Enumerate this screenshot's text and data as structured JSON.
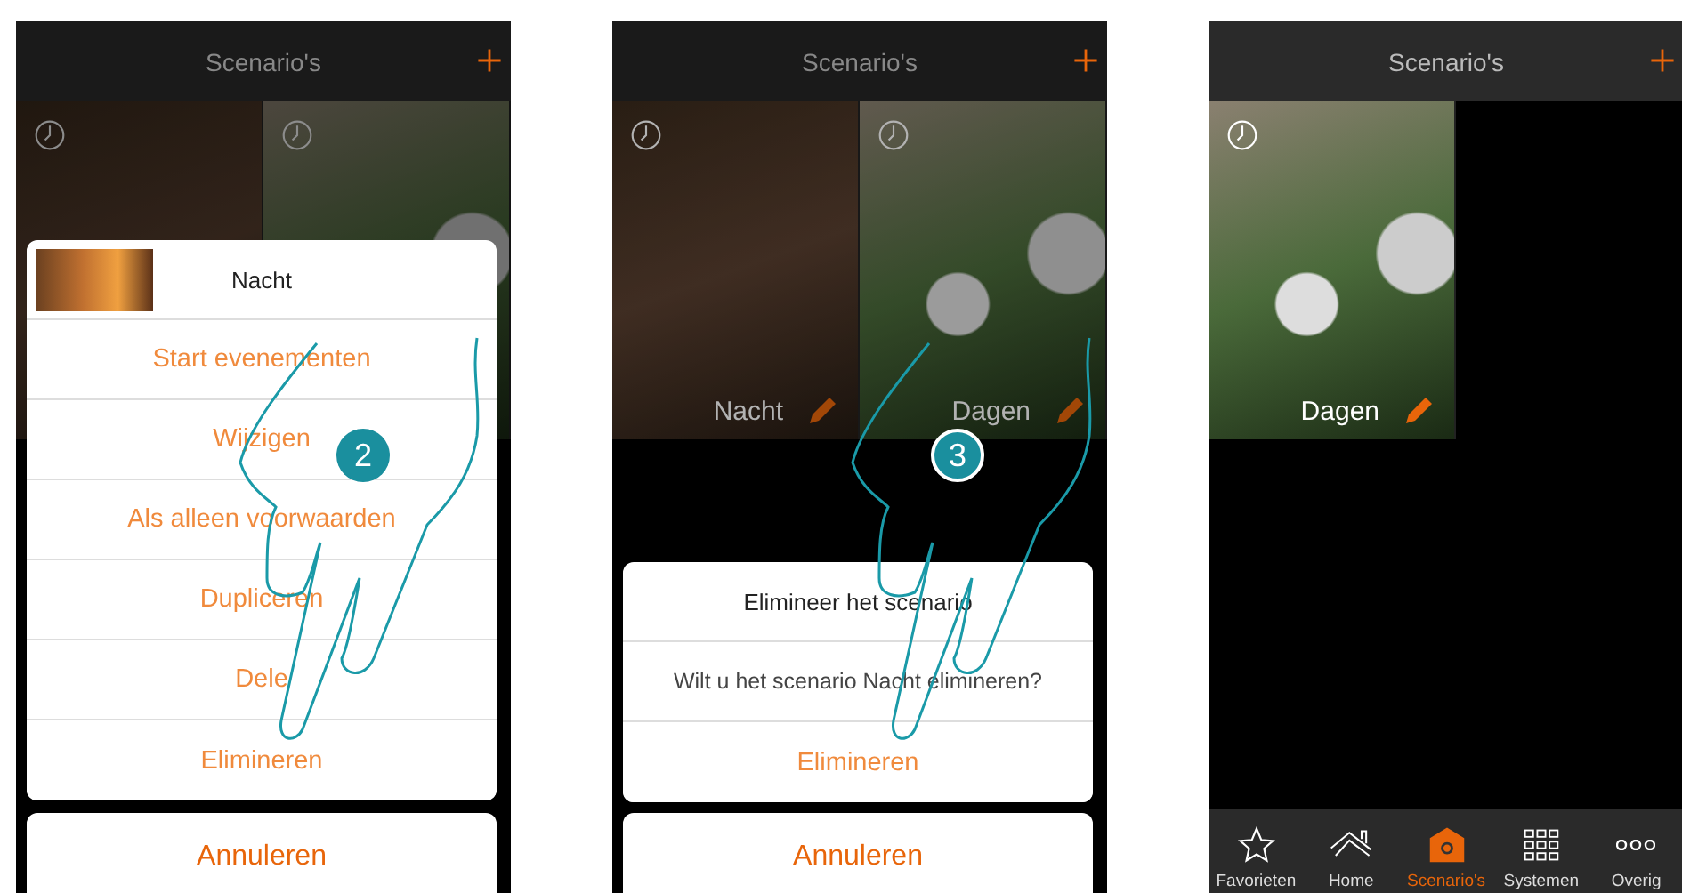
{
  "screens": [
    {
      "kind": "menu",
      "title": "Scenario's",
      "tiles": [
        {
          "kind": "fireplace"
        },
        {
          "kind": "flowers"
        }
      ],
      "sheet": {
        "title": "Nacht",
        "items": [
          "Start evenementen",
          "Wijzigen",
          "Als alleen voorwaarden",
          "Dupliceren",
          "Dele",
          "Elimineren"
        ]
      },
      "cancel": "Annuleren",
      "step": "2"
    },
    {
      "kind": "confirm",
      "title": "Scenario's",
      "tiles": [
        {
          "kind": "fireplace",
          "label": "Nacht"
        },
        {
          "kind": "flowers",
          "label": "Dagen"
        }
      ],
      "dialog": {
        "title": "Elimineer het scenario",
        "message": "Wilt u het scenario Nacht elimineren?",
        "action": "Elimineren"
      },
      "cancel": "Annuleren",
      "step": "3"
    },
    {
      "kind": "list",
      "title": "Scenario's",
      "tiles": [
        {
          "kind": "flowers",
          "label": "Dagen"
        }
      ],
      "tabs": [
        {
          "label": "Favorieten",
          "kind": "star",
          "selected": false
        },
        {
          "label": "Home",
          "kind": "house",
          "selected": false
        },
        {
          "label": "Scenario's",
          "kind": "scenario",
          "selected": true
        },
        {
          "label": "Systemen",
          "kind": "grid",
          "selected": false
        },
        {
          "label": "Overig",
          "kind": "dots",
          "selected": false
        }
      ]
    }
  ]
}
